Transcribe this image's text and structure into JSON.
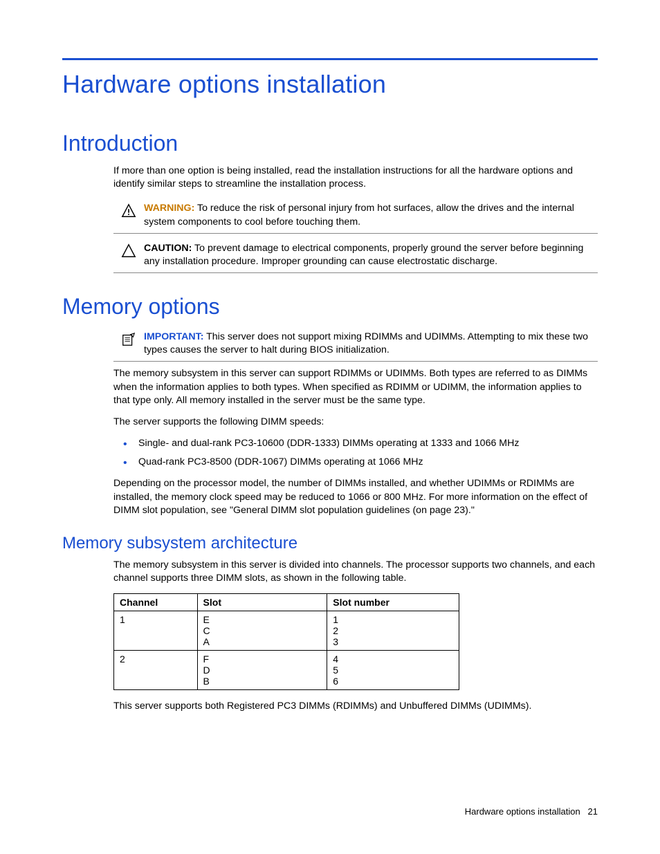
{
  "title": "Hardware options installation",
  "introduction": {
    "heading": "Introduction",
    "lead": "If more than one option is being installed, read the installation instructions for all the hardware options and identify similar steps to streamline the installation process.",
    "warning": {
      "label": "WARNING:",
      "text": "To reduce the risk of personal injury from hot surfaces, allow the drives and the internal system components to cool before touching them."
    },
    "caution": {
      "label": "CAUTION:",
      "text": "To prevent damage to electrical components, properly ground the server before beginning any installation procedure. Improper grounding can cause electrostatic discharge."
    }
  },
  "memory": {
    "heading": "Memory options",
    "important": {
      "label": "IMPORTANT:",
      "text": "This server does not support mixing RDIMMs and UDIMMs. Attempting to mix these two types causes the server to halt during BIOS initialization."
    },
    "para1": "The memory subsystem in this server can support RDIMMs or UDIMMs. Both types are referred to as DIMMs when the information applies to both types. When specified as RDIMM or UDIMM, the information applies to that type only. All memory installed in the server must be the same type.",
    "speeds_intro": "The server supports the following DIMM speeds:",
    "speeds": [
      "Single- and dual-rank PC3-10600 (DDR-1333) DIMMs operating at 1333 and 1066 MHz",
      "Quad-rank PC3-8500 (DDR-1067) DIMMs operating at 1066 MHz"
    ],
    "para2": "Depending on the processor model, the number of DIMMs installed, and whether UDIMMs or RDIMMs are installed, the memory clock speed may be reduced to 1066 or 800 MHz. For more information on the effect of DIMM slot population, see \"General DIMM slot population guidelines (on page 23).\""
  },
  "subsystem": {
    "heading": "Memory subsystem architecture",
    "intro": "The memory subsystem in this server is divided into channels. The processor supports two channels, and each channel supports three DIMM slots, as shown in the following table.",
    "table": {
      "headers": {
        "c0": "Channel",
        "c1": "Slot",
        "c2": "Slot number"
      },
      "rows": [
        {
          "channel": "1",
          "slots": "E\nC\nA",
          "nums": "1\n2\n3"
        },
        {
          "channel": "2",
          "slots": "F\nD\nB",
          "nums": "4\n5\n6"
        }
      ]
    },
    "outro": "This server supports both Registered PC3 DIMMs (RDIMMs) and Unbuffered DIMMs (UDIMMs)."
  },
  "footer": {
    "section": "Hardware options installation",
    "page": "21"
  }
}
